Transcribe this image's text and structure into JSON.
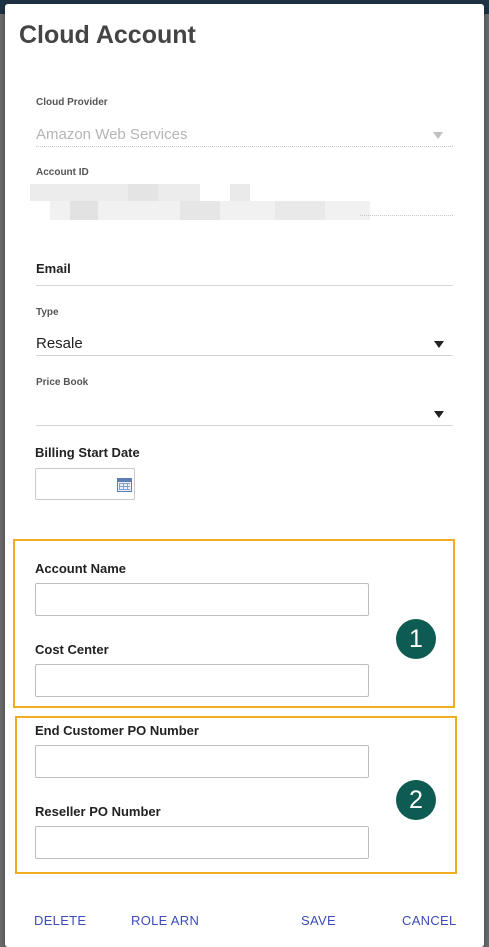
{
  "dialog": {
    "title": "Cloud Account"
  },
  "fields": {
    "cloud_provider": {
      "label": "Cloud Provider",
      "value": "Amazon Web Services",
      "icon": "chevron-down-icon"
    },
    "account_id": {
      "label": "Account ID",
      "value": ""
    },
    "email": {
      "label": "Email",
      "value": ""
    },
    "type": {
      "label": "Type",
      "value": "Resale",
      "icon": "chevron-down-icon"
    },
    "price_book": {
      "label": "Price Book",
      "value": "",
      "icon": "chevron-down-icon"
    },
    "billing_start_date": {
      "label": "Billing Start Date",
      "value": "",
      "icon": "calendar-icon"
    },
    "account_name": {
      "label": "Account Name",
      "value": ""
    },
    "cost_center": {
      "label": "Cost Center",
      "value": ""
    },
    "end_customer_po": {
      "label": "End Customer PO Number",
      "value": ""
    },
    "reseller_po": {
      "label": "Reseller PO Number",
      "value": ""
    }
  },
  "callouts": [
    {
      "number": "1"
    },
    {
      "number": "2"
    }
  ],
  "colors": {
    "highlight": "#f0ad1f",
    "badge": "#0d5b52",
    "action_text": "#3b4cb8"
  },
  "actions": {
    "delete": "DELETE",
    "role_arn": "ROLE ARN",
    "save": "SAVE",
    "cancel": "CANCEL"
  }
}
